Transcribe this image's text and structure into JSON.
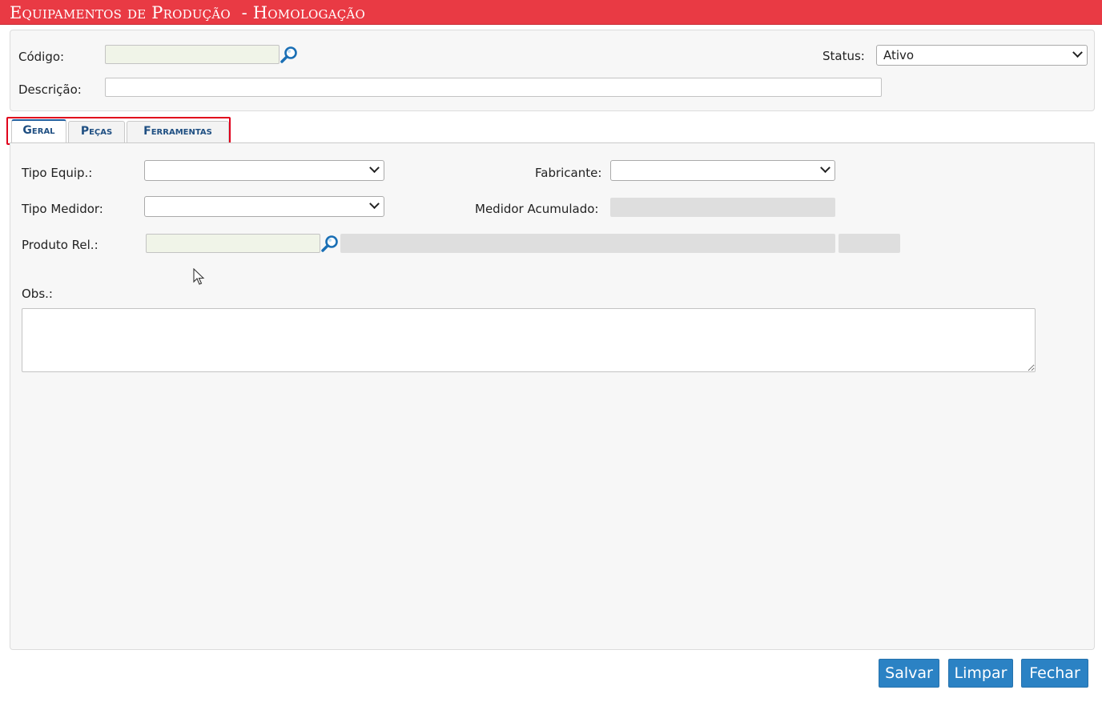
{
  "window": {
    "title": "Equipamentos de Produção  - Homologação"
  },
  "header": {
    "codigo_label": "Código:",
    "codigo_value": "",
    "status_label": "Status:",
    "status_value": "Ativo",
    "descricao_label": "Descrição:",
    "descricao_value": ""
  },
  "tabs": [
    {
      "label": "Geral",
      "active": true
    },
    {
      "label": "Peças",
      "active": false
    },
    {
      "label": "Ferramentas",
      "active": false
    }
  ],
  "geral": {
    "tipo_equip_label": "Tipo Equip.:",
    "tipo_equip_value": "",
    "fabricante_label": "Fabricante:",
    "fabricante_value": "",
    "tipo_medidor_label": "Tipo Medidor:",
    "tipo_medidor_value": "",
    "medidor_acumulado_label": "Medidor Acumulado:",
    "medidor_acumulado_value": "",
    "produto_rel_label": "Produto Rel.:",
    "produto_rel_code": "",
    "produto_rel_desc": "",
    "produto_rel_unit": "",
    "obs_label": "Obs.:",
    "obs_value": ""
  },
  "footer": {
    "salvar_label": "Salvar",
    "limpar_label": "Limpar",
    "fechar_label": "Fechar"
  },
  "colors": {
    "title_bar": "#e93a44",
    "tab_text": "#1f4f82",
    "button": "#2b82c4",
    "highlight": "#e0001b"
  },
  "icons": {
    "lookup": "magnifier-icon",
    "dropdown": "chevron-down-icon",
    "pointer": "mouse-cursor-icon"
  }
}
